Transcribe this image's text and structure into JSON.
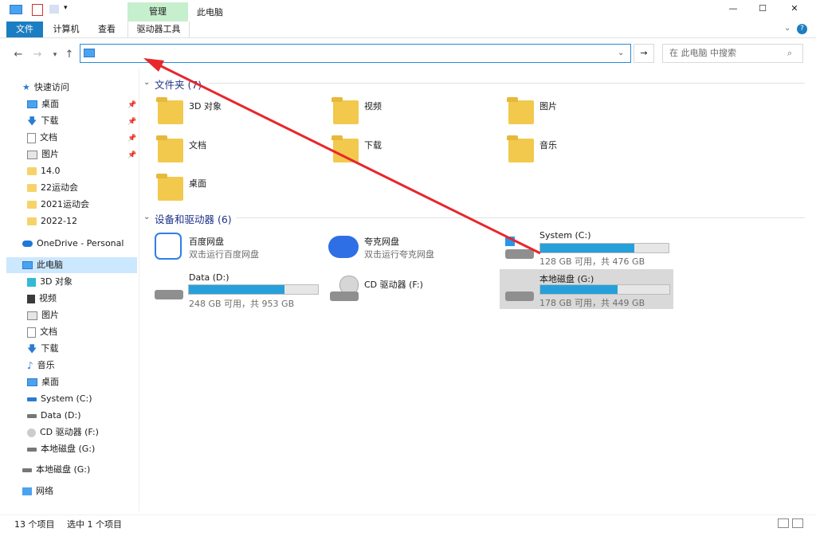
{
  "window": {
    "title": "此电脑",
    "context_tab_header": "管理",
    "controls": [
      "—",
      "☐",
      "✕"
    ]
  },
  "ribbon": {
    "tabs": [
      "文件",
      "计算机",
      "查看",
      "驱动器工具"
    ]
  },
  "address": {
    "path_value": "",
    "search_placeholder": "在 此电脑 中搜索"
  },
  "nav_pane": {
    "quick_access": "快速访问",
    "quick_items": [
      "桌面",
      "下载",
      "文档",
      "图片",
      "14.0",
      "22运动会",
      "2021运动会",
      "2022-12"
    ],
    "onedrive": "OneDrive - Personal",
    "this_pc": "此电脑",
    "pc_items": [
      "3D 对象",
      "视频",
      "图片",
      "文档",
      "下载",
      "音乐",
      "桌面",
      "System (C:)",
      "Data (D:)",
      "CD 驱动器 (F:)",
      "本地磁盘 (G:)"
    ],
    "extra_drive": "本地磁盘 (G:)",
    "network": "网络"
  },
  "folders": {
    "heading": "文件夹 (7)",
    "items": [
      "3D 对象",
      "视频",
      "图片",
      "文档",
      "下载",
      "音乐",
      "桌面"
    ]
  },
  "devices": {
    "heading": "设备和驱动器 (6)",
    "baidu": {
      "name": "百度网盘",
      "sub": "双击运行百度网盘"
    },
    "kuake": {
      "name": "夸克网盘",
      "sub": "双击运行夸克网盘"
    },
    "drives": [
      {
        "name": "System (C:)",
        "sub": "128 GB 可用，共 476 GB",
        "used_fraction": 0.73
      },
      {
        "name": "Data (D:)",
        "sub": "248 GB 可用，共 953 GB",
        "used_fraction": 0.74
      },
      {
        "name": "本地磁盘 (G:)",
        "sub": "178 GB 可用，共 449 GB",
        "used_fraction": 0.6
      }
    ],
    "cd": {
      "name": "CD 驱动器 (F:)"
    }
  },
  "status": {
    "count": "13 个项目",
    "selected": "选中 1 个项目"
  },
  "colors": {
    "accent": "#1c7ec2",
    "capacity_fill": "#26a0da",
    "context_tab": "#c6efce",
    "annotation_arrow": "#e8262c"
  }
}
